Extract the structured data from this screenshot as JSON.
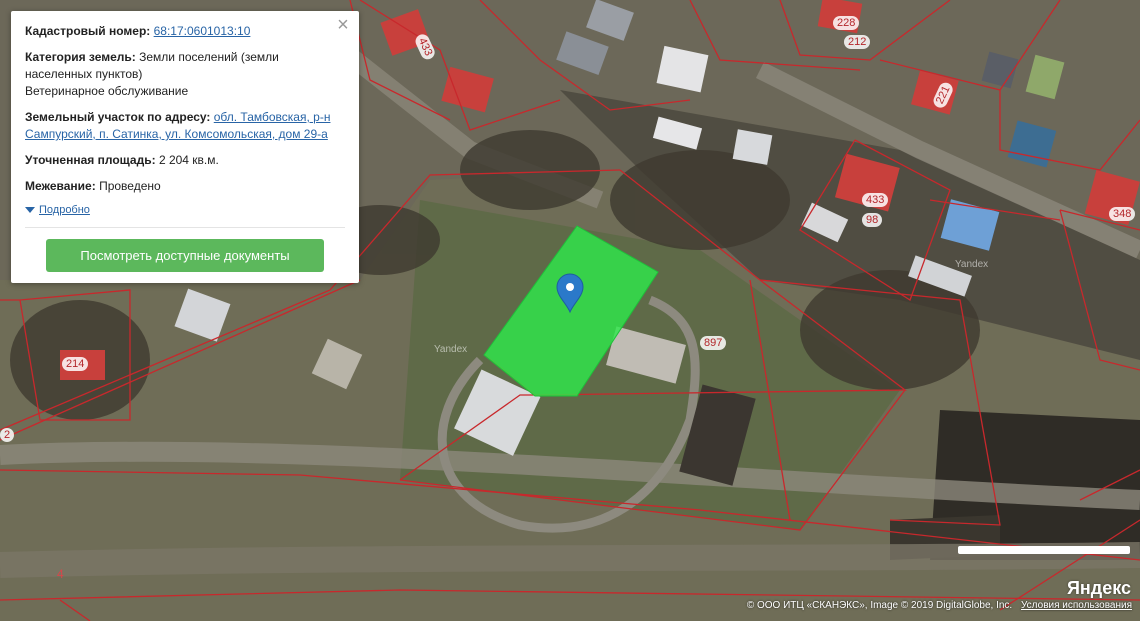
{
  "card": {
    "cadastral_label": "Кадастровый номер:",
    "cadastral_value": "68:17:0601013:10",
    "category_label": "Категория земель:",
    "category_value": "Земли поселений (земли населенных пунктов)",
    "category_use": "Ветеринарное обслуживание",
    "address_label": "Земельный участок по адресу:",
    "address_value": "обл. Тамбовская, р-н Сампурский, п. Сатинка, ул. Комсомольская, дом 29-а",
    "area_label": "Уточненная площадь:",
    "area_value": "2 204 кв.м.",
    "survey_label": "Межевание:",
    "survey_value": "Проведено",
    "more_label": "Подробно",
    "docs_button": "Посмотреть доступные документы",
    "close_symbol": "×"
  },
  "lot_labels": [
    "228",
    "212",
    "433",
    "221",
    "433",
    "98",
    "348",
    "214",
    "897",
    "4",
    "2"
  ],
  "watermarks": [
    "Yandex",
    "Yandex"
  ],
  "brand": "Яндекс",
  "copyright": "© ООО ИТЦ «СКАНЭКС», Image © 2019 DigitalGlobe, Inc.",
  "terms_link": "Условия использования",
  "colors": {
    "parcel_fill": "#2ee84a",
    "boundary": "#c8282c",
    "marker": "#2b79c9",
    "button": "#5cb85c",
    "link": "#2864a6"
  },
  "icons": {
    "marker": "map-pin-icon",
    "close": "close-icon",
    "expand": "caret-down-icon"
  }
}
